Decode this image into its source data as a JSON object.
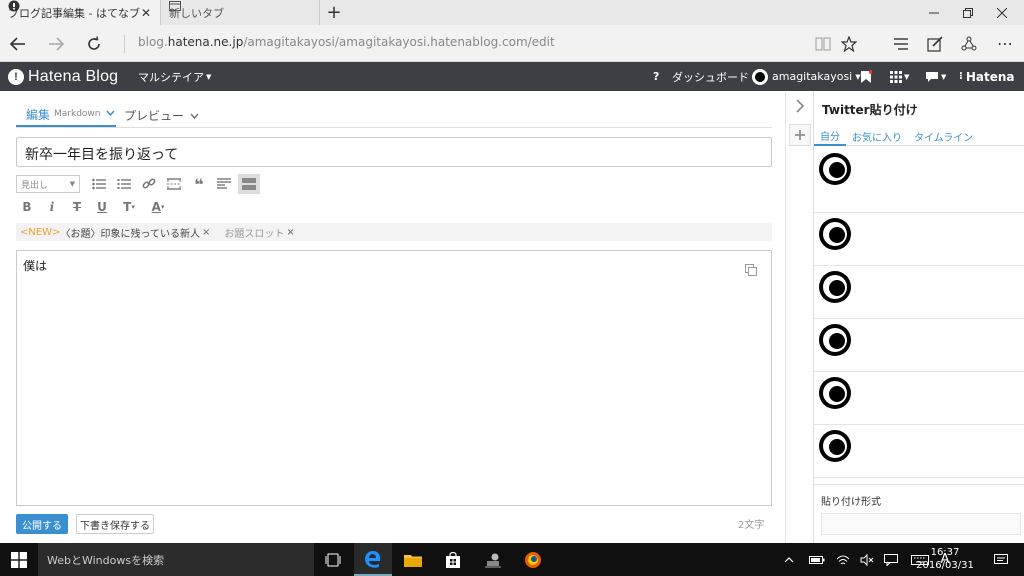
{
  "browser": {
    "tabs": [
      {
        "title": "ブログ記事編集 - はてなブ",
        "close": "✕"
      },
      {
        "title": "新しいタブ"
      }
    ],
    "new_tab": "+",
    "url_prefix": "blog.",
    "url_host": "hatena.ne.jp",
    "url_path": "/amagitakayosi/amagitakayosi.hatenablog.com/edit",
    "more": "⋯"
  },
  "header": {
    "logo": "Hatena Blog",
    "blog_menu": "マルシテイア",
    "help": "?",
    "dashboard": "ダッシュボード",
    "user": "amagitakayosi",
    "brand": "Hatena"
  },
  "editor": {
    "tab_edit": "編集",
    "tab_edit_mode": "Markdown",
    "tab_preview": "プレビュー",
    "title_value": "新卒一年目を振り返って",
    "heading_select": "見出し",
    "topic_new": "<NEW>",
    "topic_title": "〈お題〉印象に残っている新人",
    "topic_slot": "お題スロット",
    "body_text": "僕は",
    "publish": "公開する",
    "save_draft": "下書き保存する",
    "char_count": "2文字",
    "toolbar2": {
      "bold": "B",
      "italic": "i",
      "strike": "T",
      "underline": "U",
      "fontsize": "T",
      "color": "A"
    }
  },
  "twitter": {
    "title": "Twitter貼り付け",
    "tabs": [
      "自分",
      "お気に入り",
      "タイムライン"
    ],
    "format_label": "貼り付け形式"
  },
  "taskbar": {
    "search_placeholder": "WebとWindowsを検索",
    "ime": "A",
    "time": "16:37",
    "date": "2016/03/31"
  },
  "colors": {
    "accent": "#3a8fd0",
    "header_bg": "#3d3f44",
    "topic_new": "#f0a030"
  }
}
